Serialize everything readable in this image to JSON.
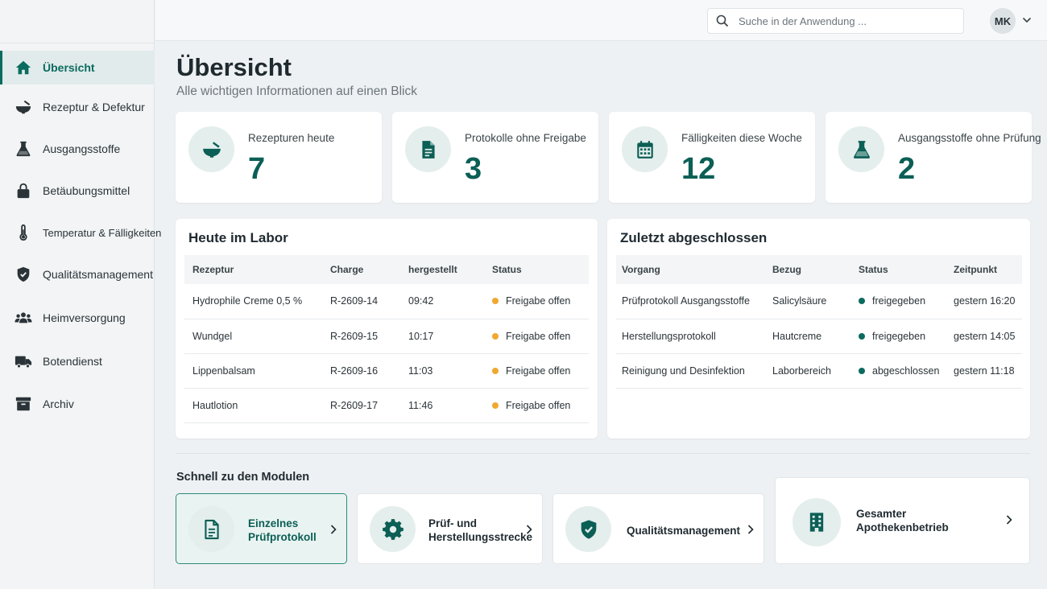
{
  "sidebar": {
    "items": [
      {
        "label": "Übersicht",
        "icon": "home-icon"
      },
      {
        "label": "Rezeptur & Defektur",
        "icon": "mortar-icon"
      },
      {
        "label": "Ausgangsstoffe",
        "icon": "flask-icon"
      },
      {
        "label": "Betäubungsmittel",
        "icon": "lock-icon"
      },
      {
        "label": "Temperatur & Fälligkeiten",
        "icon": "thermometer-icon"
      },
      {
        "label": "Qualitätsmanagement",
        "icon": "shield-icon"
      },
      {
        "label": "Heimversorgung",
        "icon": "people-icon"
      },
      {
        "label": "Botendienst",
        "icon": "truck-icon"
      },
      {
        "label": "Archiv",
        "icon": "archive-icon"
      }
    ]
  },
  "topbar": {
    "search_placeholder": "Suche in der Anwendung ...",
    "user_initials": "MK"
  },
  "page": {
    "title": "Übersicht",
    "subtitle": "Alle wichtigen Informationen auf einen Blick"
  },
  "kpis": [
    {
      "label": "Rezepturen heute",
      "value": "7",
      "icon": "mortar-icon"
    },
    {
      "label": "Protokolle ohne Freigabe",
      "value": "3",
      "icon": "document-icon"
    },
    {
      "label": "Fälligkeiten diese Woche",
      "value": "12",
      "icon": "calendar-icon"
    },
    {
      "label": "Ausgangsstoffe ohne Prüfung",
      "value": "2",
      "icon": "flask-icon"
    }
  ],
  "lab": {
    "title": "Heute im Labor",
    "columns": [
      "Rezeptur",
      "Charge",
      "hergestellt",
      "Status"
    ],
    "rows": [
      {
        "rezeptur": "Hydrophile Creme 0,5 %",
        "charge": "R-2609-14",
        "hergestellt": "09:42",
        "status": "Freigabe offen"
      },
      {
        "rezeptur": "Wundgel",
        "charge": "R-2609-15",
        "hergestellt": "10:17",
        "status": "Freigabe offen"
      },
      {
        "rezeptur": "Lippenbalsam",
        "charge": "R-2609-16",
        "hergestellt": "11:03",
        "status": "Freigabe offen"
      },
      {
        "rezeptur": "Hautlotion",
        "charge": "R-2609-17",
        "hergestellt": "11:46",
        "status": "Freigabe offen"
      }
    ]
  },
  "recent": {
    "title": "Zuletzt abgeschlossen",
    "columns": [
      "Vorgang",
      "Bezug",
      "Status",
      "Zeitpunkt"
    ],
    "rows": [
      {
        "vorgang": "Prüfprotokoll Ausgangsstoffe",
        "bezug": "Salicylsäure",
        "status": "freigegeben",
        "zeitpunkt": "gestern 16:20"
      },
      {
        "vorgang": "Herstellungsprotokoll",
        "bezug": "Hautcreme",
        "status": "freigegeben",
        "zeitpunkt": "gestern 14:05"
      },
      {
        "vorgang": "Reinigung und Desinfektion",
        "bezug": "Laborbereich",
        "status": "abgeschlossen",
        "zeitpunkt": "gestern 11:18"
      }
    ]
  },
  "modules": {
    "title": "Schnell zu den Modulen",
    "items": [
      {
        "line1": "Einzelnes",
        "line2": "Prüfprotokoll",
        "icon": "document-icon"
      },
      {
        "line1": "Prüf- und",
        "line2": "Herstellungsstrecke",
        "icon": "gear-icon"
      },
      {
        "line1": "Qualitätsmanagement",
        "line2": "",
        "icon": "shield-icon"
      },
      {
        "line1": "Gesamter",
        "line2": "Apothekenbetrieb",
        "icon": "building-icon"
      }
    ]
  },
  "colors": {
    "accent": "#0b6b5f",
    "status_open": "#f0a830",
    "status_done": "#0b6b5f"
  }
}
